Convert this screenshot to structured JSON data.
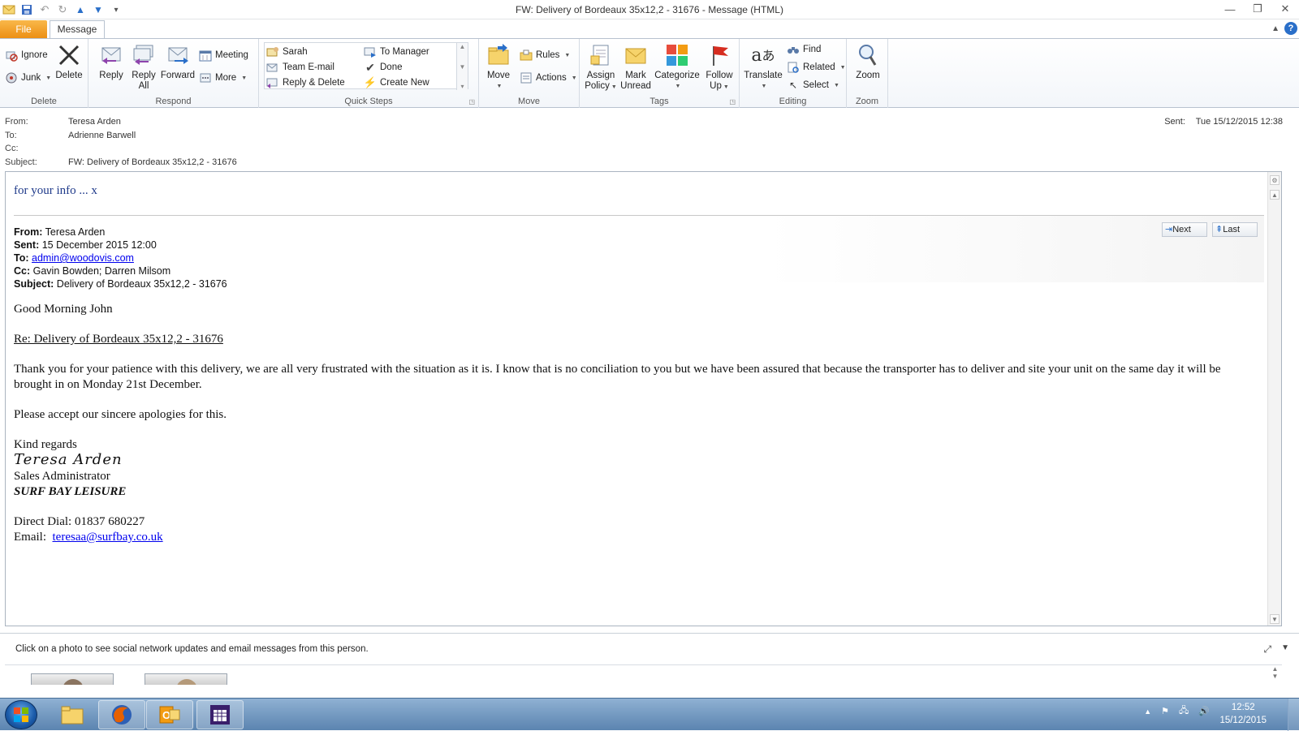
{
  "window": {
    "title": "FW: Delivery of Bordeaux 35x12,2 - 31676  -  Message (HTML)"
  },
  "tabs": {
    "file": "File",
    "message": "Message"
  },
  "ribbon": {
    "delete": {
      "label": "Delete",
      "ignore": "Ignore",
      "junk": "Junk",
      "delete": "Delete"
    },
    "respond": {
      "label": "Respond",
      "reply": "Reply",
      "reply_all_1": "Reply",
      "reply_all_2": "All",
      "forward": "Forward",
      "meeting": "Meeting",
      "more": "More"
    },
    "quick_steps": {
      "label": "Quick Steps",
      "items": [
        "Sarah",
        "To Manager",
        "Team E-mail",
        "Done",
        "Reply & Delete",
        "Create New"
      ]
    },
    "move": {
      "label": "Move",
      "move": "Move",
      "rules": "Rules",
      "actions": "Actions"
    },
    "tags": {
      "label": "Tags",
      "assign_1": "Assign",
      "assign_2": "Policy",
      "mark_1": "Mark",
      "mark_2": "Unread",
      "categorize": "Categorize",
      "follow_1": "Follow",
      "follow_2": "Up"
    },
    "editing": {
      "label": "Editing",
      "translate": "Translate",
      "find": "Find",
      "related": "Related",
      "select": "Select"
    },
    "zoom": {
      "label": "Zoom",
      "zoom": "Zoom"
    }
  },
  "header": {
    "from_label": "From:",
    "from": "Teresa Arden",
    "to_label": "To:",
    "to": "Adrienne Barwell",
    "cc_label": "Cc:",
    "cc": "",
    "subject_label": "Subject:",
    "subject": "FW: Delivery of Bordeaux 35x12,2 - 31676",
    "sent_label": "Sent:",
    "sent": "Tue 15/12/2015 12:38"
  },
  "body": {
    "fyi": "for your info ... x",
    "fwd": {
      "from_label": "From:",
      "from": " Teresa Arden",
      "sent_label": "Sent:",
      "sent": " 15 December 2015 12:00",
      "to_label": "To:",
      "to": "admin@woodovis.com",
      "cc_label": "Cc:",
      "cc": " Gavin Bowden; Darren Milsom",
      "subject_label": "Subject:",
      "subject": " Delivery of Bordeaux 35x12,2 - 31676"
    },
    "nav_next": "Next",
    "nav_last": "Last",
    "greeting": "Good Morning John",
    "re_line": "Re: Delivery of Bordeaux 35x12,2 - 31676",
    "para1": "Thank you for your patience with this delivery, we are all very frustrated with the situation as it is.  I know that is no conciliation to you but we have been assured that because the transporter has to deliver and site your unit on the same day it will be brought in on Monday 21st December.",
    "para2": "Please accept our sincere apologies for this.",
    "kind_regards": "Kind regards",
    "signature": "Teresa Arden",
    "role": "Sales Administrator",
    "company": "SURF BAY LEISURE",
    "direct_dial": "Direct Dial:  01837 680227",
    "email_label": "Email:  ",
    "email": "teresaa@surfbay.co.uk"
  },
  "people_pane": {
    "text": "Click on a photo to see social network updates and email messages from this person."
  },
  "taskbar": {
    "time": "12:52",
    "date": "15/12/2015"
  }
}
